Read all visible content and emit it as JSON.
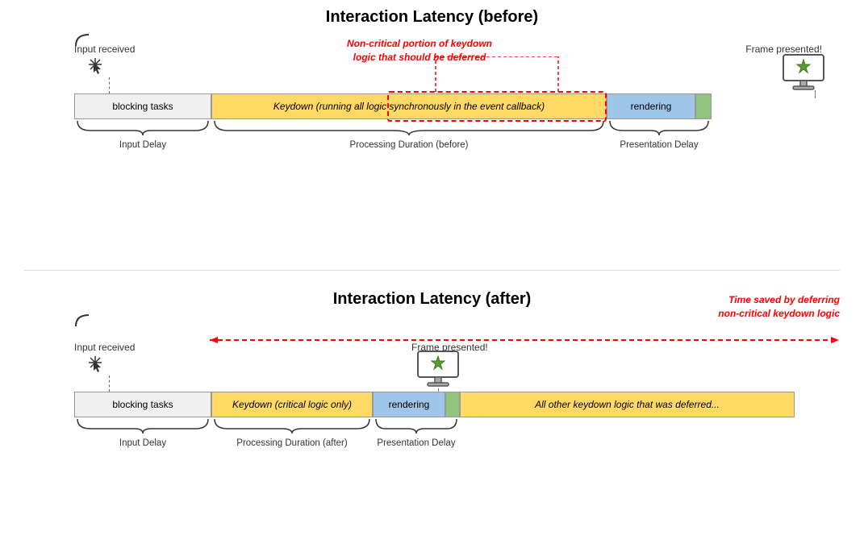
{
  "top": {
    "title": "Interaction Latency (before)",
    "input_received": "Input received",
    "frame_presented": "Frame presented!",
    "red_annotation": "Non-critical portion of keydown\nlogic that should be deferred",
    "bars": {
      "blocking": "blocking tasks",
      "keydown": "Keydown (running all logic synchronously in the event callback)",
      "rendering": "rendering"
    },
    "labels": {
      "input_delay": "Input Delay",
      "processing_duration": "Processing Duration (before)",
      "presentation_delay": "Presentation Delay"
    }
  },
  "bottom": {
    "title": "Interaction Latency (after)",
    "input_received": "Input received",
    "frame_presented": "Frame presented!",
    "time_saved": "Time saved by deferring\nnon-critical keydown logic",
    "bars": {
      "blocking": "blocking tasks",
      "keydown": "Keydown (critical logic only)",
      "rendering": "rendering",
      "deferred": "All other keydown logic that was deferred..."
    },
    "labels": {
      "input_delay": "Input Delay",
      "processing_duration": "Processing Duration (after)",
      "presentation_delay": "Presentation Delay"
    }
  }
}
